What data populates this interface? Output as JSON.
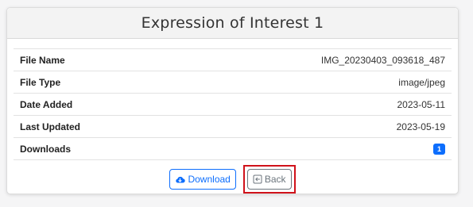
{
  "header": {
    "title": "Expression of Interest 1"
  },
  "details": {
    "rows": [
      {
        "label": "File Name",
        "value": "IMG_20230403_093618_487"
      },
      {
        "label": "File Type",
        "value": "image/jpeg"
      },
      {
        "label": "Date Added",
        "value": "2023-05-11"
      },
      {
        "label": "Last Updated",
        "value": "2023-05-19"
      },
      {
        "label": "Downloads",
        "value": "1"
      }
    ]
  },
  "actions": {
    "download_label": "Download",
    "back_label": "Back"
  },
  "icons": {
    "download": "cloud-download-icon",
    "back": "arrow-left-square-icon"
  },
  "colors": {
    "primary": "#0d6efd",
    "secondary": "#6c757d",
    "highlight": "#d0121b"
  }
}
